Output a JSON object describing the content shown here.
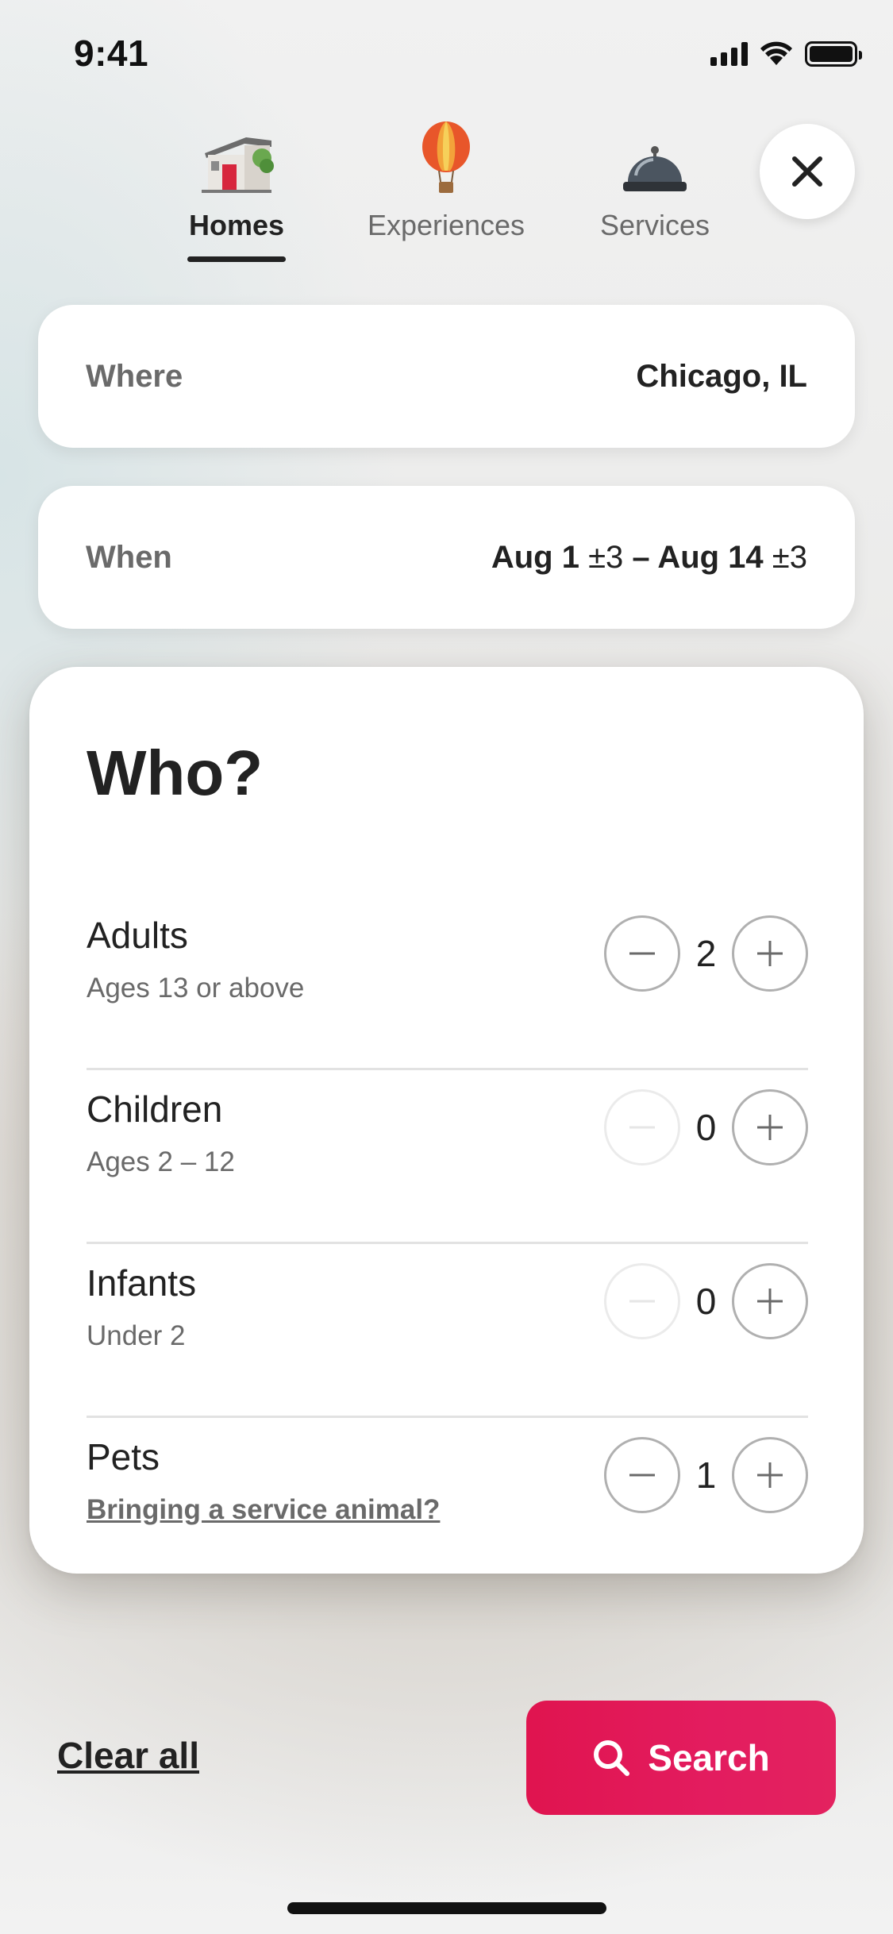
{
  "status_bar": {
    "time": "9:41"
  },
  "tabs": [
    {
      "label": "Homes",
      "icon": "house-icon",
      "active": true
    },
    {
      "label": "Experiences",
      "icon": "hot-air-balloon-icon",
      "active": false
    },
    {
      "label": "Services",
      "icon": "service-bell-icon",
      "active": false
    }
  ],
  "close": {
    "icon": "close-icon"
  },
  "where": {
    "label": "Where",
    "value": "Chicago, IL"
  },
  "when": {
    "label": "When",
    "start": "Aug 1",
    "start_flex": "±3",
    "separator": "–",
    "end": "Aug 14",
    "end_flex": "±3"
  },
  "who": {
    "title": "Who?",
    "rows": [
      {
        "name": "Adults",
        "sub": "Ages 13 or above",
        "count": "2",
        "minus_enabled": true
      },
      {
        "name": "Children",
        "sub": "Ages 2 – 12",
        "count": "0",
        "minus_enabled": false
      },
      {
        "name": "Infants",
        "sub": "Under 2",
        "count": "0",
        "minus_enabled": false
      },
      {
        "name": "Pets",
        "sub": "Bringing a service animal?",
        "count": "1",
        "minus_enabled": true
      }
    ]
  },
  "footer": {
    "clear_label": "Clear all",
    "search_label": "Search"
  },
  "colors": {
    "brand": "#e31c5f",
    "text": "#222222",
    "muted": "#6a6a6a"
  }
}
